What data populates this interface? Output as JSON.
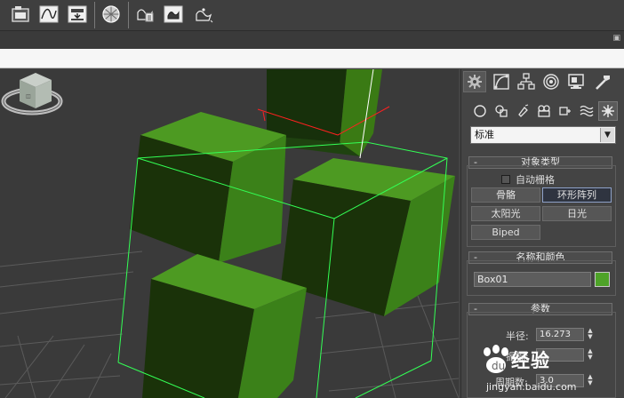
{
  "toolbar": {
    "icons": [
      "layer-manager-icon",
      "curve-editor-icon",
      "schematic-view-icon",
      "material-editor-icon",
      "render-setup-icon",
      "rendered-frame-icon",
      "render-icon"
    ]
  },
  "command_panel": {
    "tabs": [
      "create-tab",
      "modify-tab",
      "hierarchy-tab",
      "motion-tab",
      "display-tab",
      "utilities-tab"
    ],
    "categories": [
      "geometry",
      "shapes",
      "lights",
      "cameras",
      "helpers",
      "space-warps",
      "systems"
    ],
    "subcategory": "标准",
    "object_type": {
      "title": "对象类型",
      "autogrid_label": "自动栅格",
      "buttons": [
        "骨骼",
        "环形阵列",
        "太阳光",
        "日光",
        "Biped"
      ],
      "active_button": "环形阵列"
    },
    "name_color": {
      "title": "名称和颜色",
      "name_value": "Box01",
      "swatch_color": "#4ea328"
    },
    "parameters": {
      "title": "参数",
      "radius_label": "半径:",
      "radius_value": "16.273",
      "row2_label": "振幅:",
      "row3_label": "周期数:",
      "row3_value": "3.0"
    }
  },
  "watermark": {
    "brand": "经验",
    "url": "jingyan.baidu.com"
  },
  "colors": {
    "accent_green": "#4ea328",
    "selection_wire": "#33ff55"
  }
}
